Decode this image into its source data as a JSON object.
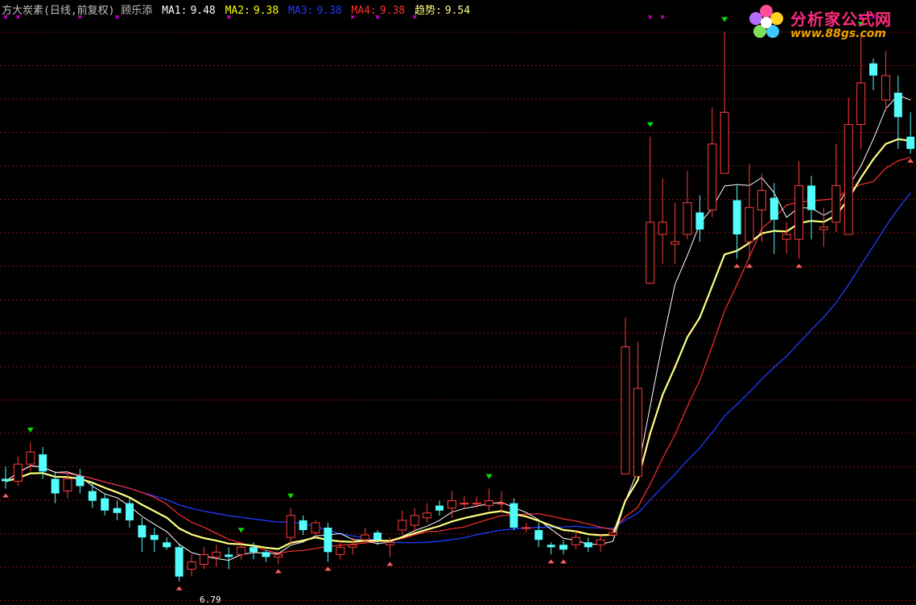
{
  "header": {
    "title": "方大炭素(日线,前复权) 顾乐添",
    "items": [
      {
        "label": "MA1:",
        "value": "9.48",
        "color": "#ffffff"
      },
      {
        "label": "MA2:",
        "value": "9.38",
        "color": "#ffff00"
      },
      {
        "label": "MA3:",
        "value": "9.38",
        "color": "#1e3cff"
      },
      {
        "label": "MA4:",
        "value": "9.38",
        "color": "#ff3030"
      },
      {
        "label": "趋势:",
        "value": "9.54",
        "color": "#ffff80"
      }
    ]
  },
  "logo": {
    "name": "分析家公式网",
    "url": "www.88gs.com"
  },
  "low_label": "6.79",
  "chart_data": {
    "type": "candlestick",
    "price_range": [
      6.6,
      11.4
    ],
    "grid": "dotted horizontal red",
    "colors": {
      "up": "#ff3c3c",
      "down": "#54fcfc",
      "ma1": "#ffffff",
      "trend": "#ffff80",
      "ma3": "#1e3cff",
      "ma4": "#ff3030",
      "buy_arrow": "#ff5a5a",
      "sell_arrow": "#00e000",
      "marker": "#ff00ff"
    },
    "candles": [
      [
        7.6,
        7.58,
        7.7,
        7.52
      ],
      [
        7.58,
        7.72,
        7.78,
        7.54
      ],
      [
        7.72,
        7.82,
        7.9,
        7.66
      ],
      [
        7.8,
        7.66,
        7.86,
        7.6
      ],
      [
        7.6,
        7.48,
        7.66,
        7.4
      ],
      [
        7.5,
        7.6,
        7.66,
        7.44
      ],
      [
        7.62,
        7.54,
        7.68,
        7.48
      ],
      [
        7.5,
        7.42,
        7.56,
        7.36
      ],
      [
        7.44,
        7.34,
        7.48,
        7.3
      ],
      [
        7.36,
        7.32,
        7.42,
        7.26
      ],
      [
        7.4,
        7.26,
        7.44,
        7.2
      ],
      [
        7.22,
        7.12,
        7.28,
        7.0
      ],
      [
        7.14,
        7.1,
        7.2,
        7.0
      ],
      [
        7.08,
        7.04,
        7.12,
        7.02
      ],
      [
        7.04,
        6.8,
        7.06,
        6.76
      ],
      [
        6.86,
        6.92,
        6.98,
        6.8
      ],
      [
        6.9,
        6.98,
        7.04,
        6.86
      ],
      [
        6.96,
        7.0,
        7.06,
        6.88
      ],
      [
        6.98,
        6.96,
        7.04,
        6.86
      ],
      [
        6.98,
        7.04,
        7.08,
        6.94
      ],
      [
        7.04,
        7.0,
        7.08,
        6.94
      ],
      [
        7.0,
        6.96,
        7.02,
        6.92
      ],
      [
        6.96,
        6.98,
        7.0,
        6.9
      ],
      [
        7.12,
        7.3,
        7.36,
        7.06
      ],
      [
        7.26,
        7.18,
        7.3,
        7.14
      ],
      [
        7.16,
        7.24,
        7.26,
        7.12
      ],
      [
        7.2,
        7.0,
        7.24,
        6.92
      ],
      [
        6.98,
        7.04,
        7.1,
        6.94
      ],
      [
        7.04,
        7.06,
        7.12,
        6.98
      ],
      [
        7.1,
        7.14,
        7.2,
        7.08
      ],
      [
        7.16,
        7.1,
        7.18,
        7.06
      ],
      [
        7.06,
        7.08,
        7.12,
        6.96
      ],
      [
        7.18,
        7.26,
        7.34,
        7.14
      ],
      [
        7.22,
        7.3,
        7.36,
        7.16
      ],
      [
        7.28,
        7.32,
        7.4,
        7.24
      ],
      [
        7.38,
        7.34,
        7.42,
        7.3
      ],
      [
        7.36,
        7.42,
        7.5,
        7.28
      ],
      [
        7.4,
        7.4,
        7.46,
        7.36
      ],
      [
        7.4,
        7.4,
        7.46,
        7.36
      ],
      [
        7.38,
        7.42,
        7.52,
        7.34
      ],
      [
        7.4,
        7.4,
        7.5,
        7.32
      ],
      [
        7.4,
        7.2,
        7.44,
        7.18
      ],
      [
        7.2,
        7.2,
        7.24,
        7.16
      ],
      [
        7.18,
        7.1,
        7.24,
        7.04
      ],
      [
        7.06,
        7.04,
        7.08,
        6.98
      ],
      [
        7.06,
        7.02,
        7.1,
        6.98
      ],
      [
        7.06,
        7.12,
        7.18,
        7.02
      ],
      [
        7.08,
        7.04,
        7.12,
        7.0
      ],
      [
        7.06,
        7.1,
        7.14,
        7.0
      ],
      [
        7.14,
        7.16,
        7.18,
        7.12
      ],
      [
        7.64,
        8.68,
        8.92,
        7.64
      ],
      [
        7.62,
        8.34,
        8.72,
        7.62
      ],
      [
        9.2,
        9.7,
        10.4,
        9.2
      ],
      [
        9.6,
        9.7,
        10.06,
        9.36
      ],
      [
        9.52,
        9.54,
        9.86,
        9.36
      ],
      [
        9.6,
        9.86,
        10.12,
        9.56
      ],
      [
        9.78,
        9.64,
        9.92,
        9.54
      ],
      [
        9.8,
        10.34,
        10.64,
        9.74
      ],
      [
        10.1,
        10.6,
        11.26,
        10.1
      ],
      [
        9.88,
        9.6,
        10.0,
        9.4
      ],
      [
        9.54,
        9.82,
        10.18,
        9.4
      ],
      [
        9.8,
        9.96,
        10.1,
        9.54
      ],
      [
        9.9,
        9.72,
        10.02,
        9.44
      ],
      [
        9.56,
        9.6,
        9.7,
        9.44
      ],
      [
        9.56,
        10.0,
        10.2,
        9.4
      ],
      [
        10.0,
        9.8,
        10.08,
        9.56
      ],
      [
        9.64,
        9.66,
        9.82,
        9.5
      ],
      [
        9.7,
        10.0,
        10.34,
        9.62
      ],
      [
        9.6,
        10.5,
        10.72,
        9.6
      ],
      [
        10.5,
        10.84,
        11.22,
        10.3
      ],
      [
        11.0,
        10.9,
        11.04,
        10.78
      ],
      [
        10.7,
        10.9,
        11.1,
        10.62
      ],
      [
        10.76,
        10.56,
        10.9,
        10.3
      ],
      [
        10.4,
        10.3,
        10.6,
        10.26
      ]
    ],
    "markers_top": [
      0,
      1,
      6,
      9,
      18,
      28,
      30,
      33,
      52,
      53,
      64,
      67,
      69,
      70,
      76,
      77,
      78,
      79
    ]
  }
}
